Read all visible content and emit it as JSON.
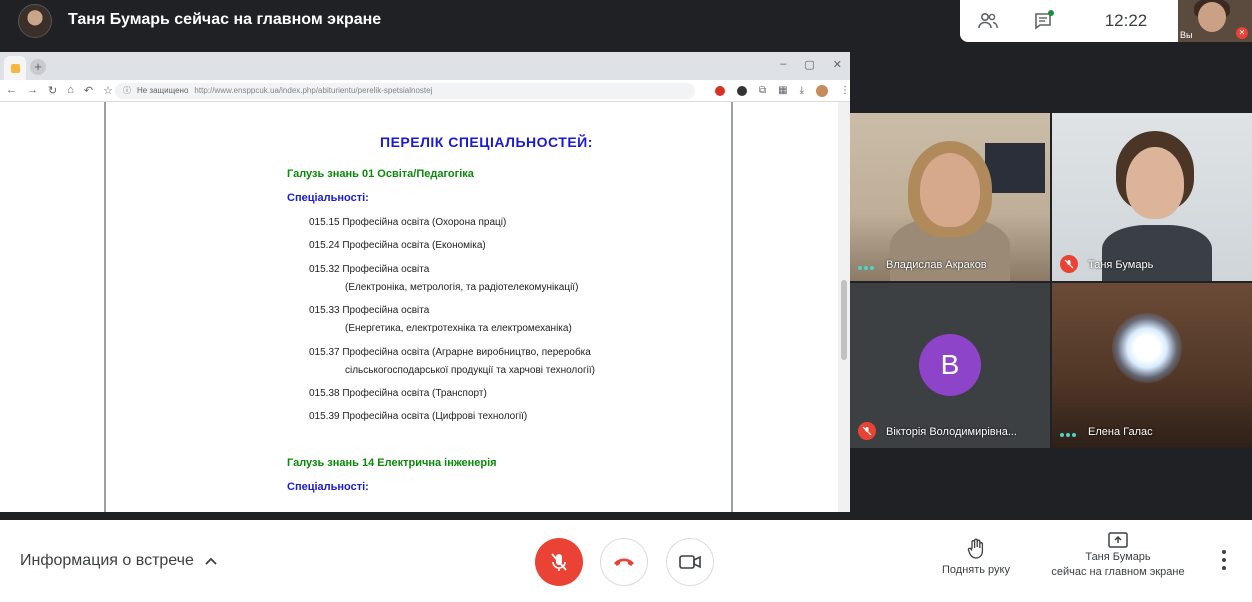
{
  "header": {
    "presenter_title": "Таня Бумарь сейчас на главном экране",
    "clock": "12:22",
    "self_view_label": "Вы"
  },
  "browser": {
    "security_label": "Не защищено",
    "url": "http://www.ensppcuk.ua/index.php/abiturientu/perelik-spetsialnostej"
  },
  "document": {
    "title": "ПЕРЕЛІК СПЕЦІАЛЬНОСТЕЙ:",
    "field1": "Галузь знань 01 Освіта/Педагогіка",
    "spec_head1": "Спеціальності:",
    "items": [
      "015.15 Професійна освіта (Охорона праці)",
      "015.24 Професійна освіта (Економіка)",
      "015.32 Професійна освіта",
      "(Електроніка, метрологія, та радіотелекомунікації)",
      "015.33 Професійна освіта",
      "(Енергетика, електротехніка та електромеханіка)",
      "015.37 Професійна освіта (Аграрне виробництво, переробка",
      "сільськогосподарської продукції та харчові технології)",
      "015.38 Професійна освіта (Транспорт)",
      "015.39 Професійна освіта (Цифрові технології)"
    ],
    "field2": "Галузь знань 14 Електрична інженерія",
    "spec_head2": "Спеціальності:"
  },
  "participants": [
    {
      "name": "Владислав Акраков",
      "status": "speaking"
    },
    {
      "name": "Таня Бумарь",
      "status": "muted"
    },
    {
      "name": "Вікторія Володимирівна...",
      "status": "muted",
      "initial": "В"
    },
    {
      "name": "Елена Галас",
      "status": "speaking"
    }
  ],
  "footer": {
    "meeting_info": "Информация о встрече",
    "raise_hand": "Поднять руку",
    "present_line1": "Таня Бумарь",
    "present_line2": "сейчас на главном экране"
  },
  "colors": {
    "accent_red": "#ea4335",
    "avatar_purple": "#8e44c9",
    "doc_blue": "#1a1ad4",
    "doc_green": "#0a8a0a"
  }
}
